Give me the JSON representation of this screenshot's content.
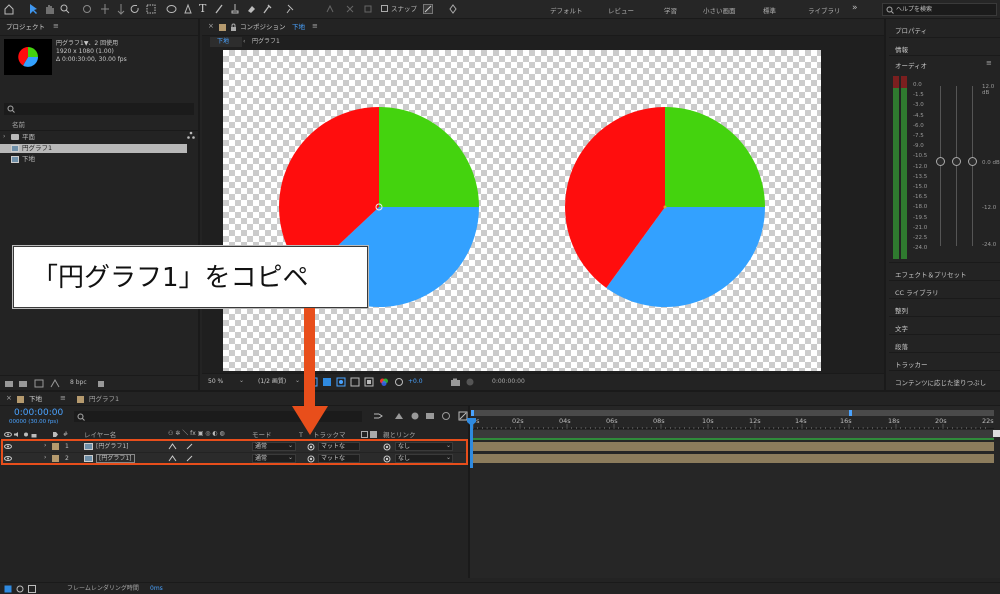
{
  "toolbar": {
    "snap_label": "スナップ",
    "workspaces": [
      "デフォルト",
      "レビュー",
      "学習",
      "小さい画面",
      "標準",
      "ライブラリ"
    ],
    "help_placeholder": "ヘルプを検索"
  },
  "project": {
    "title": "プロジェクト",
    "item_name": "円グラフ1▼、2 回使用",
    "item_size": "1920 x 1080 (1.00)",
    "item_duration": "Δ 0:00:30:00, 30.00 fps",
    "col_name": "名前",
    "items": [
      {
        "name": "平面",
        "type": "folder"
      },
      {
        "name": "円グラフ1",
        "type": "comp"
      },
      {
        "name": "下地",
        "type": "comp"
      }
    ],
    "bpc": "8 bpc"
  },
  "comp": {
    "title_prefix": "コンポジション",
    "title_name": "下地",
    "breadcrumb_active": "下地",
    "breadcrumb_next": "円グラフ1",
    "zoom": "50 %",
    "resolution": "(1/2 画質)",
    "exposure": "+0.0",
    "timecode": "0:00:00:00"
  },
  "callout": {
    "text": "「円グラフ1」をコピペ"
  },
  "right_panel": {
    "items_top": [
      "プロパティ",
      "情報",
      "オーディオ"
    ],
    "meter_labels": [
      "0.0",
      "-1.5",
      "-3.0",
      "-4.5",
      "-6.0",
      "-7.5",
      "-9.0",
      "-10.5",
      "-12.0",
      "-13.5",
      "-15.0",
      "-16.5",
      "-18.0",
      "-19.5",
      "-21.0",
      "-22.5",
      "-24.0"
    ],
    "meter_right_labels": [
      "12.0 dB",
      "0.0 dB",
      "-12.0",
      "-24.0"
    ],
    "items_bottom": [
      "エフェクト＆プリセット",
      "CC ライブラリ",
      "整列",
      "文字",
      "段落",
      "トラッカー",
      "コンテンツに応じた塗りつぶし"
    ]
  },
  "timeline": {
    "tabs": [
      "下地",
      "円グラフ1"
    ],
    "timecode": "0:00:00:00",
    "fps_sub": "00000 (30.00 fps)",
    "headers": {
      "layer_name": "レイヤー名",
      "mode": "モード",
      "t": "T",
      "trackmatte": "トラックマ",
      "parent": "親とリンク"
    },
    "layers": [
      {
        "num": "1",
        "name": "[円グラフ1]",
        "mode": "通常",
        "matte": "マットな",
        "parent": "なし"
      },
      {
        "num": "2",
        "name": "[円グラフ1]",
        "mode": "通常",
        "matte": "マットな",
        "parent": "なし"
      }
    ],
    "ruler": [
      "0s",
      "02s",
      "04s",
      "06s",
      "08s",
      "10s",
      "12s",
      "14s",
      "16s",
      "18s",
      "20s",
      "22s"
    ],
    "status": "フレームレンダリング時間",
    "status_value": "0ms"
  },
  "chart_data": [
    {
      "type": "pie",
      "name": "",
      "slices": [
        {
          "color": "#44d30e",
          "value": 25
        },
        {
          "color": "#33a1ff",
          "value": 38
        },
        {
          "color": "#ff0d0d",
          "value": 37
        }
      ],
      "start_angle_deg": 0
    },
    {
      "type": "pie",
      "name": "",
      "slices": [
        {
          "color": "#44d30e",
          "value": 25
        },
        {
          "color": "#33a1ff",
          "value": 35
        },
        {
          "color": "#ff0d0d",
          "value": 40
        }
      ],
      "start_angle_deg": 0
    }
  ],
  "colors": {
    "accent_blue": "#2f8ae0",
    "callout_border": "#3a3a3a",
    "arrow": "#e84e1b",
    "selection_red": "#e84e1b",
    "layer_label": "#b59a6e"
  }
}
